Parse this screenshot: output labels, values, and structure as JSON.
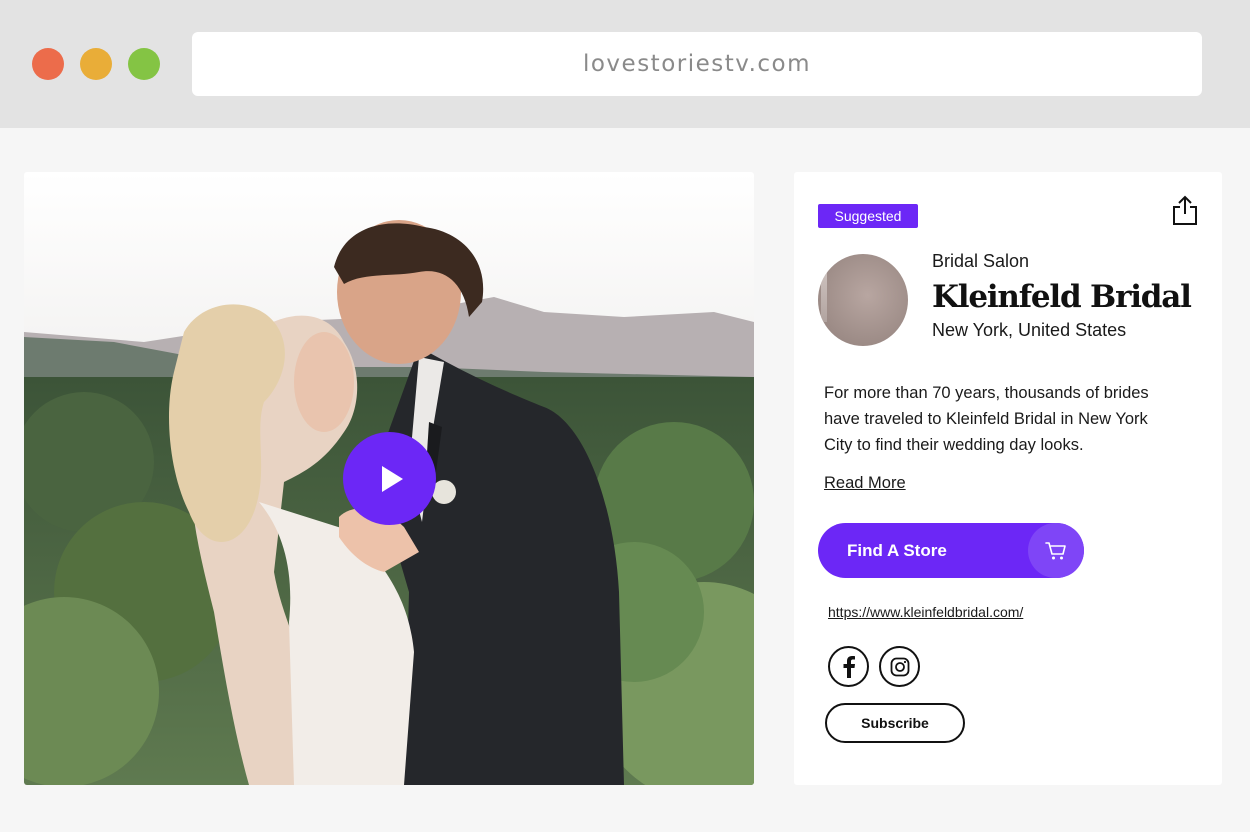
{
  "browser": {
    "url": "lovestoriestv.com"
  },
  "video": {
    "play_icon": "play-icon"
  },
  "vendor": {
    "badge": "Suggested",
    "category": "Bridal Salon",
    "name": "Kleinfeld Bridal",
    "location": "New York, United States",
    "description": "For more than 70 years, thousands of brides have traveled to Kleinfeld Bridal in New York City to find their wedding day looks.",
    "read_more": "Read More",
    "cta_label": "Find A Store",
    "cta_icon": "cart-icon",
    "website": "https://www.kleinfeldbridal.com/",
    "subscribe_label": "Subscribe",
    "social": [
      "facebook-icon",
      "instagram-icon"
    ],
    "share_icon": "share-icon"
  },
  "colors": {
    "accent": "#6c27f6",
    "traffic_red": "#ec6c4b",
    "traffic_yellow": "#e9ad38",
    "traffic_green": "#84c444"
  }
}
